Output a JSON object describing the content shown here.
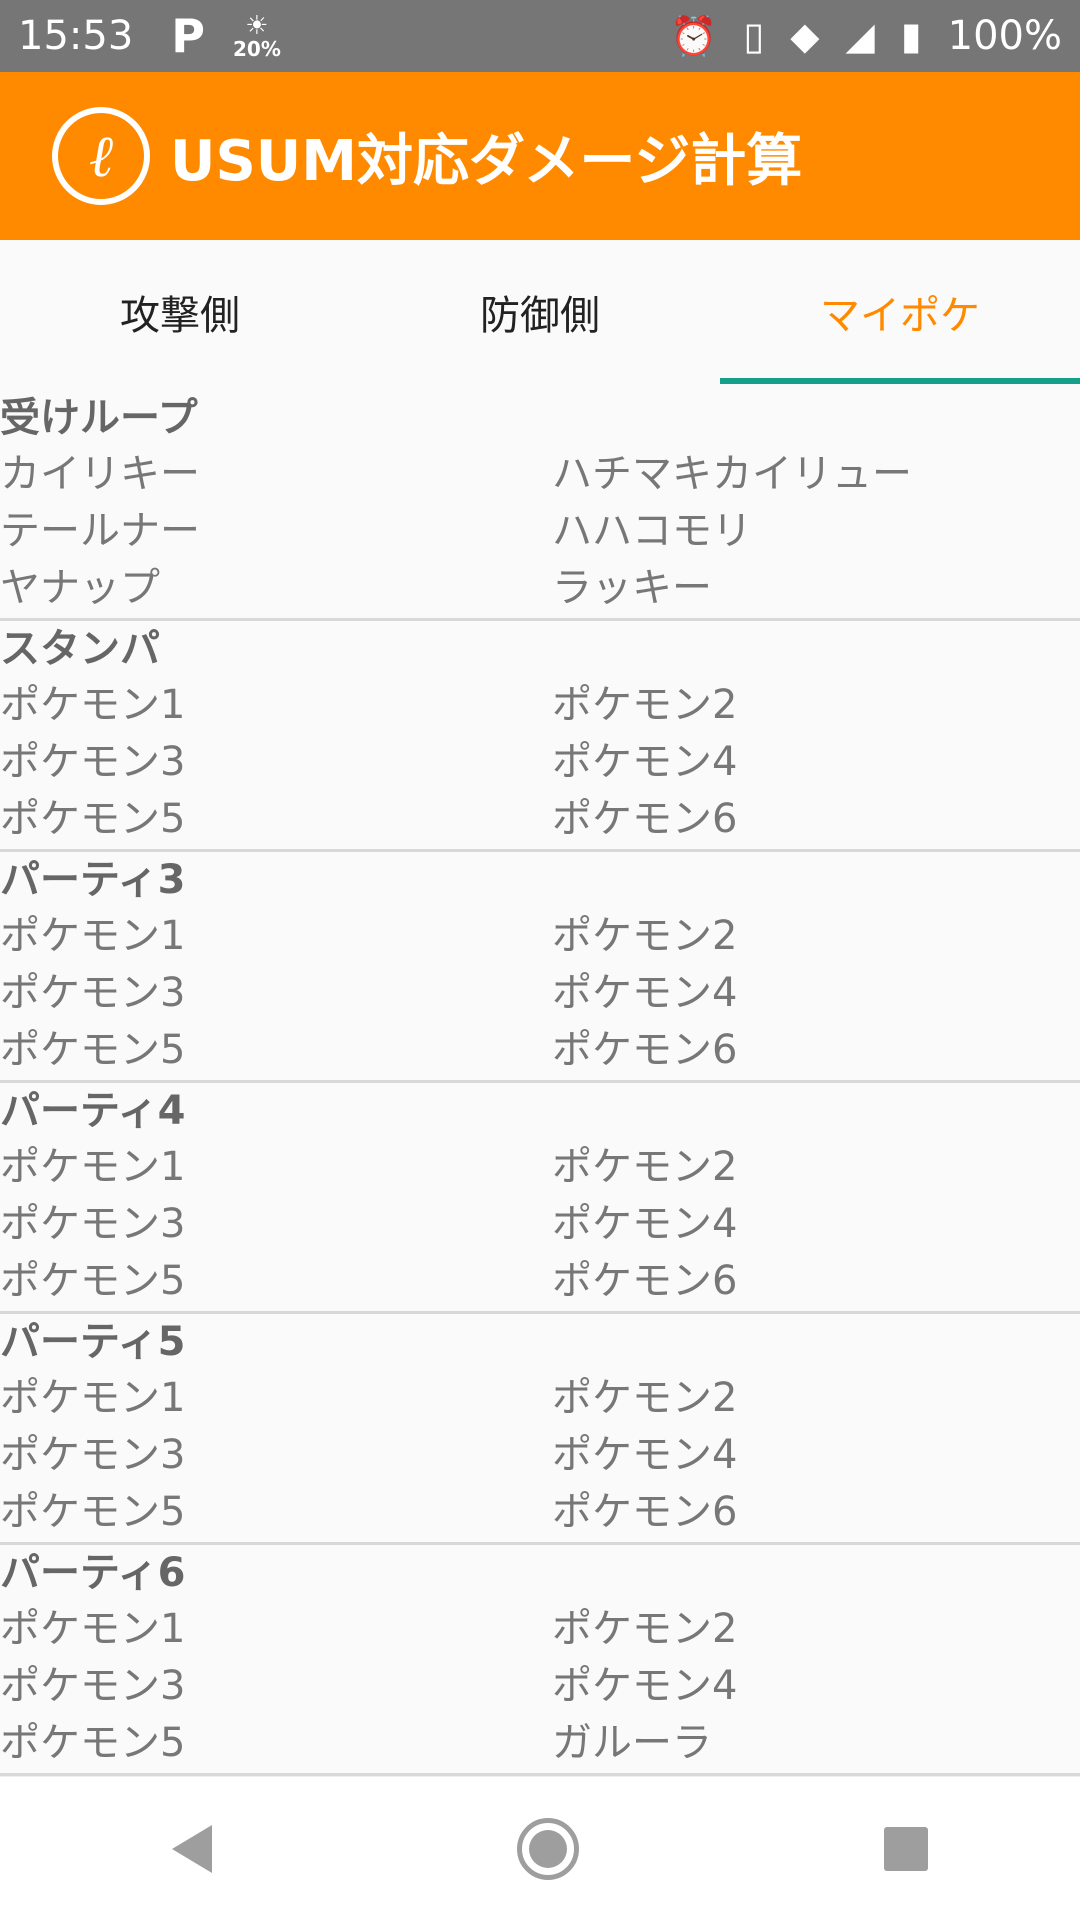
{
  "status_bar": {
    "time": "15:53",
    "parking_icon": "P",
    "weather_percent": "20%",
    "battery_text": "100%"
  },
  "app_bar": {
    "title": "USUM対応ダメージ計算"
  },
  "tabs": [
    {
      "label": "攻撃側",
      "active": false
    },
    {
      "label": "防御側",
      "active": false
    },
    {
      "label": "マイポケ",
      "active": true
    }
  ],
  "parties": [
    {
      "title": "受けループ",
      "members": [
        "カイリキー",
        "ハチマキカイリュー",
        "テールナー",
        "ハハコモリ",
        "ヤナップ",
        "ラッキー"
      ]
    },
    {
      "title": "スタンパ",
      "members": [
        "ポケモン1",
        "ポケモン2",
        "ポケモン3",
        "ポケモン4",
        "ポケモン5",
        "ポケモン6"
      ]
    },
    {
      "title": "パーティ3",
      "members": [
        "ポケモン1",
        "ポケモン2",
        "ポケモン3",
        "ポケモン4",
        "ポケモン5",
        "ポケモン6"
      ]
    },
    {
      "title": "パーティ4",
      "members": [
        "ポケモン1",
        "ポケモン2",
        "ポケモン3",
        "ポケモン4",
        "ポケモン5",
        "ポケモン6"
      ]
    },
    {
      "title": "パーティ5",
      "members": [
        "ポケモン1",
        "ポケモン2",
        "ポケモン3",
        "ポケモン4",
        "ポケモン5",
        "ポケモン6"
      ]
    },
    {
      "title": "パーティ6",
      "members": [
        "ポケモン1",
        "ポケモン2",
        "ポケモン3",
        "ポケモン4",
        "ポケモン5",
        "ガルーラ"
      ]
    }
  ],
  "colors": {
    "accent": "#ff8a00",
    "tab_indicator": "#16a08a",
    "status_bar": "#767676"
  }
}
